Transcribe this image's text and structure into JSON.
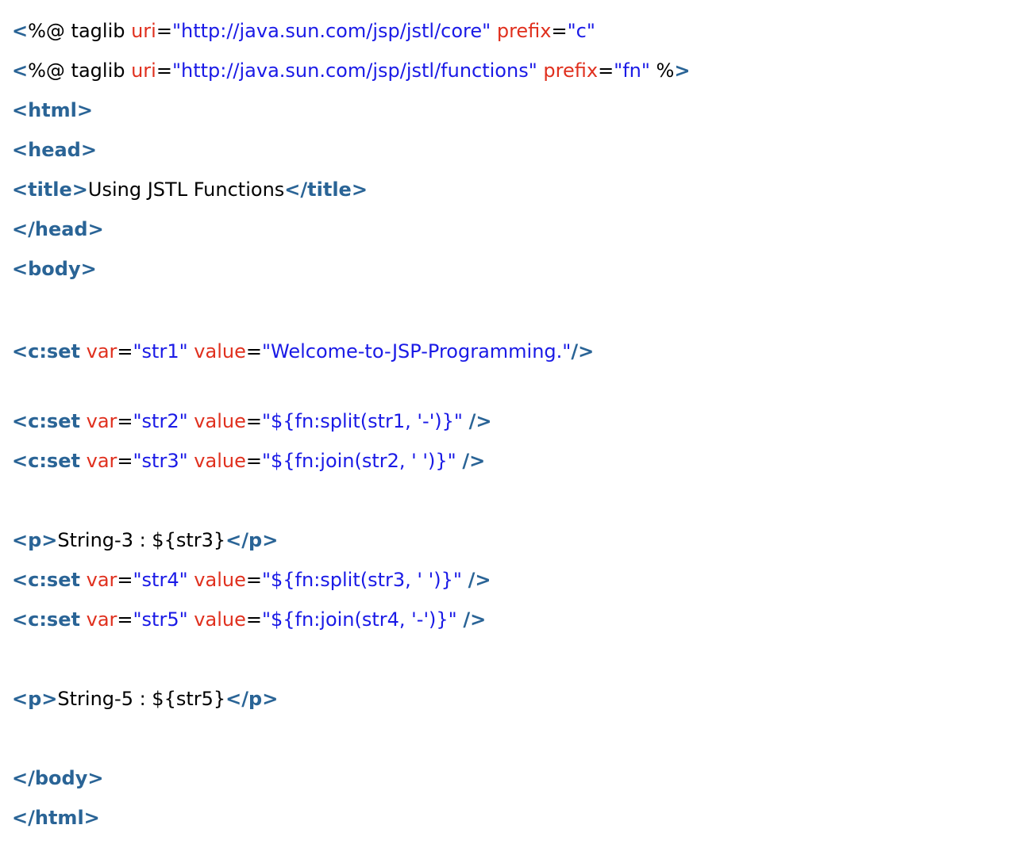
{
  "code_lines": [
    {
      "parts": [
        {
          "k": "tag",
          "t": "<"
        },
        {
          "k": "txt",
          "t": "%@ taglib "
        },
        {
          "k": "attr",
          "t": "uri"
        },
        {
          "k": "txt",
          "t": "="
        },
        {
          "k": "val",
          "t": "\"http://java.sun.com/jsp/jstl/core\""
        },
        {
          "k": "txt",
          "t": " "
        },
        {
          "k": "attr",
          "t": "prefix"
        },
        {
          "k": "txt",
          "t": "="
        },
        {
          "k": "val",
          "t": "\"c\""
        }
      ]
    },
    {
      "parts": [
        {
          "k": "tag",
          "t": "<"
        },
        {
          "k": "txt",
          "t": "%@ taglib "
        },
        {
          "k": "attr",
          "t": "uri"
        },
        {
          "k": "txt",
          "t": "="
        },
        {
          "k": "val",
          "t": "\"http://java.sun.com/jsp/jstl/functions\""
        },
        {
          "k": "txt",
          "t": " "
        },
        {
          "k": "attr",
          "t": "prefix"
        },
        {
          "k": "txt",
          "t": "="
        },
        {
          "k": "val",
          "t": "\"fn\""
        },
        {
          "k": "txt",
          "t": " %"
        },
        {
          "k": "tag",
          "t": ">"
        }
      ]
    },
    {
      "parts": [
        {
          "k": "tag",
          "t": "<html>"
        }
      ]
    },
    {
      "parts": [
        {
          "k": "tag",
          "t": "<head>"
        }
      ]
    },
    {
      "parts": [
        {
          "k": "tag",
          "t": "<title>"
        },
        {
          "k": "txt",
          "t": "Using JSTL Functions"
        },
        {
          "k": "tag",
          "t": "</title>"
        }
      ]
    },
    {
      "parts": [
        {
          "k": "tag",
          "t": "</head>"
        }
      ]
    },
    {
      "parts": [
        {
          "k": "tag",
          "t": "<body>"
        }
      ]
    },
    {
      "blank": true,
      "parts": []
    },
    {
      "wrap": true,
      "parts": [
        {
          "k": "tag",
          "t": "<c:set"
        },
        {
          "k": "txt",
          "t": " "
        },
        {
          "k": "attr",
          "t": "var"
        },
        {
          "k": "txt",
          "t": "="
        },
        {
          "k": "val",
          "t": "\"str1\""
        },
        {
          "k": "txt",
          "t": " "
        },
        {
          "k": "attr",
          "t": "value"
        },
        {
          "k": "txt",
          "t": "="
        },
        {
          "k": "val",
          "t": "\"Welcome-to-JSP-Programming.\""
        },
        {
          "k": "tag",
          "t": "/>"
        }
      ]
    },
    {
      "parts": [
        {
          "k": "tag",
          "t": "<c:set"
        },
        {
          "k": "txt",
          "t": " "
        },
        {
          "k": "attr",
          "t": "var"
        },
        {
          "k": "txt",
          "t": "="
        },
        {
          "k": "val",
          "t": "\"str2\""
        },
        {
          "k": "txt",
          "t": " "
        },
        {
          "k": "attr",
          "t": "value"
        },
        {
          "k": "txt",
          "t": "="
        },
        {
          "k": "val",
          "t": "\"${fn:split(str1, '-')}\""
        },
        {
          "k": "txt",
          "t": " "
        },
        {
          "k": "tag",
          "t": "/>"
        }
      ]
    },
    {
      "parts": [
        {
          "k": "tag",
          "t": "<c:set"
        },
        {
          "k": "txt",
          "t": " "
        },
        {
          "k": "attr",
          "t": "var"
        },
        {
          "k": "txt",
          "t": "="
        },
        {
          "k": "val",
          "t": "\"str3\""
        },
        {
          "k": "txt",
          "t": " "
        },
        {
          "k": "attr",
          "t": "value"
        },
        {
          "k": "txt",
          "t": "="
        },
        {
          "k": "val",
          "t": "\"${fn:join(str2, ' ')}\""
        },
        {
          "k": "txt",
          "t": " "
        },
        {
          "k": "tag",
          "t": "/>"
        }
      ]
    },
    {
      "blank": true,
      "parts": []
    },
    {
      "parts": [
        {
          "k": "tag",
          "t": "<p>"
        },
        {
          "k": "txt",
          "t": "String-3 : ${str3}"
        },
        {
          "k": "tag",
          "t": "</p>"
        }
      ]
    },
    {
      "parts": [
        {
          "k": "tag",
          "t": "<c:set"
        },
        {
          "k": "txt",
          "t": " "
        },
        {
          "k": "attr",
          "t": "var"
        },
        {
          "k": "txt",
          "t": "="
        },
        {
          "k": "val",
          "t": "\"str4\""
        },
        {
          "k": "txt",
          "t": " "
        },
        {
          "k": "attr",
          "t": "value"
        },
        {
          "k": "txt",
          "t": "="
        },
        {
          "k": "val",
          "t": "\"${fn:split(str3, ' ')}\""
        },
        {
          "k": "txt",
          "t": " "
        },
        {
          "k": "tag",
          "t": "/>"
        }
      ]
    },
    {
      "parts": [
        {
          "k": "tag",
          "t": "<c:set"
        },
        {
          "k": "txt",
          "t": " "
        },
        {
          "k": "attr",
          "t": "var"
        },
        {
          "k": "txt",
          "t": "="
        },
        {
          "k": "val",
          "t": "\"str5\""
        },
        {
          "k": "txt",
          "t": " "
        },
        {
          "k": "attr",
          "t": "value"
        },
        {
          "k": "txt",
          "t": "="
        },
        {
          "k": "val",
          "t": "\"${fn:join(str4, '-')}\""
        },
        {
          "k": "txt",
          "t": " "
        },
        {
          "k": "tag",
          "t": "/>"
        }
      ]
    },
    {
      "blank": true,
      "parts": []
    },
    {
      "parts": [
        {
          "k": "tag",
          "t": "<p>"
        },
        {
          "k": "txt",
          "t": "String-5 : ${str5}"
        },
        {
          "k": "tag",
          "t": "</p>"
        }
      ]
    },
    {
      "blank": true,
      "parts": []
    },
    {
      "parts": [
        {
          "k": "tag",
          "t": "</body>"
        }
      ]
    },
    {
      "parts": [
        {
          "k": "tag",
          "t": "</html>"
        }
      ]
    }
  ],
  "colors": {
    "tag": "#2a6496",
    "attribute": "#e0301e",
    "value": "#1a1ae6",
    "text": "#000000"
  }
}
